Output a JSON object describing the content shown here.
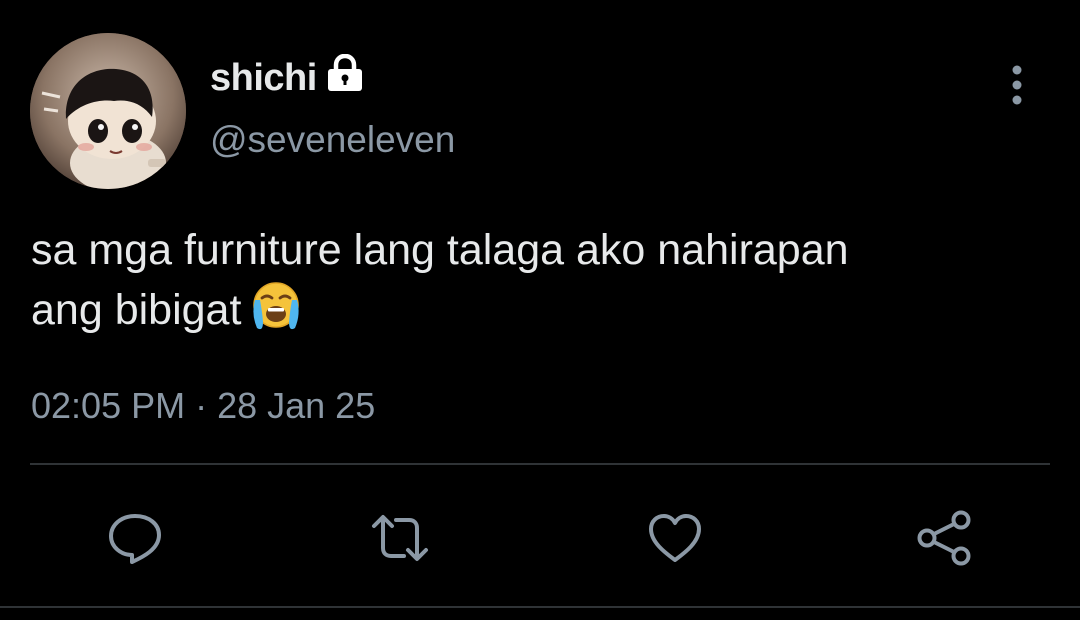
{
  "tweet": {
    "author": {
      "display_name": "shichi",
      "handle": "@seveneleven",
      "protected_icon": "lock-icon",
      "avatar": "profile-avatar"
    },
    "text_lines": [
      "sa mga furniture lang talaga ako nahirapan",
      "ang bibigat"
    ],
    "emoji": "😭",
    "timestamp": {
      "time": "02:05 PM",
      "separator": " · ",
      "date": "28 Jan 25"
    },
    "actions": [
      {
        "name": "reply",
        "icon": "speech-bubble-icon"
      },
      {
        "name": "retweet",
        "icon": "retweet-icon"
      },
      {
        "name": "like",
        "icon": "heart-icon"
      },
      {
        "name": "share",
        "icon": "share-icon"
      }
    ],
    "menu_icon": "more-vertical-icon"
  },
  "colors": {
    "background": "#000000",
    "primary_text": "#e7e9ea",
    "secondary_text": "#8b98a5",
    "divider": "#2f3336",
    "icon": "#8b98a5"
  }
}
